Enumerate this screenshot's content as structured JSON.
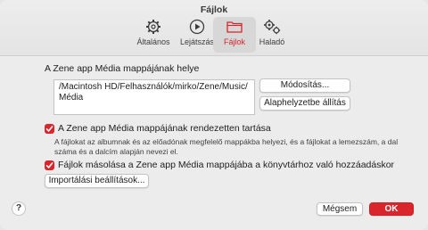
{
  "window": {
    "title": "Fájlok"
  },
  "tabs": [
    {
      "label": "Általános",
      "icon": "gear-icon"
    },
    {
      "label": "Lejátszás",
      "icon": "play-icon"
    },
    {
      "label": "Fájlok",
      "icon": "folder-icon"
    },
    {
      "label": "Haladó",
      "icon": "gears-icon"
    }
  ],
  "media_folder": {
    "heading": "A Zene app Média mappájának helye",
    "path_line1": "/Macintosh HD/Felhasználók/mirko/Zene/Music/",
    "path_line2": "Média",
    "change_button": "Módosítás...",
    "reset_button": "Alaphelyzetbe állítás"
  },
  "keep_organized": {
    "label": "A Zene app Média mappájának rendezetten tartása",
    "checked": true,
    "description": "A fájlokat az albumnak és az előadónak megfelelő mappákba helyezi, és a fájlokat a lemezszám, a dal száma és a dalcím alapján nevezi el."
  },
  "copy_files": {
    "label": "Fájlok másolása a Zene app Média mappájába a könyvtárhoz való hozzáadáskor",
    "checked": true
  },
  "import_settings_button": "Importálási beállítások...",
  "footer": {
    "help": "?",
    "cancel": "Mégsem",
    "ok": "OK"
  },
  "colors": {
    "accent": "#d9262d"
  }
}
